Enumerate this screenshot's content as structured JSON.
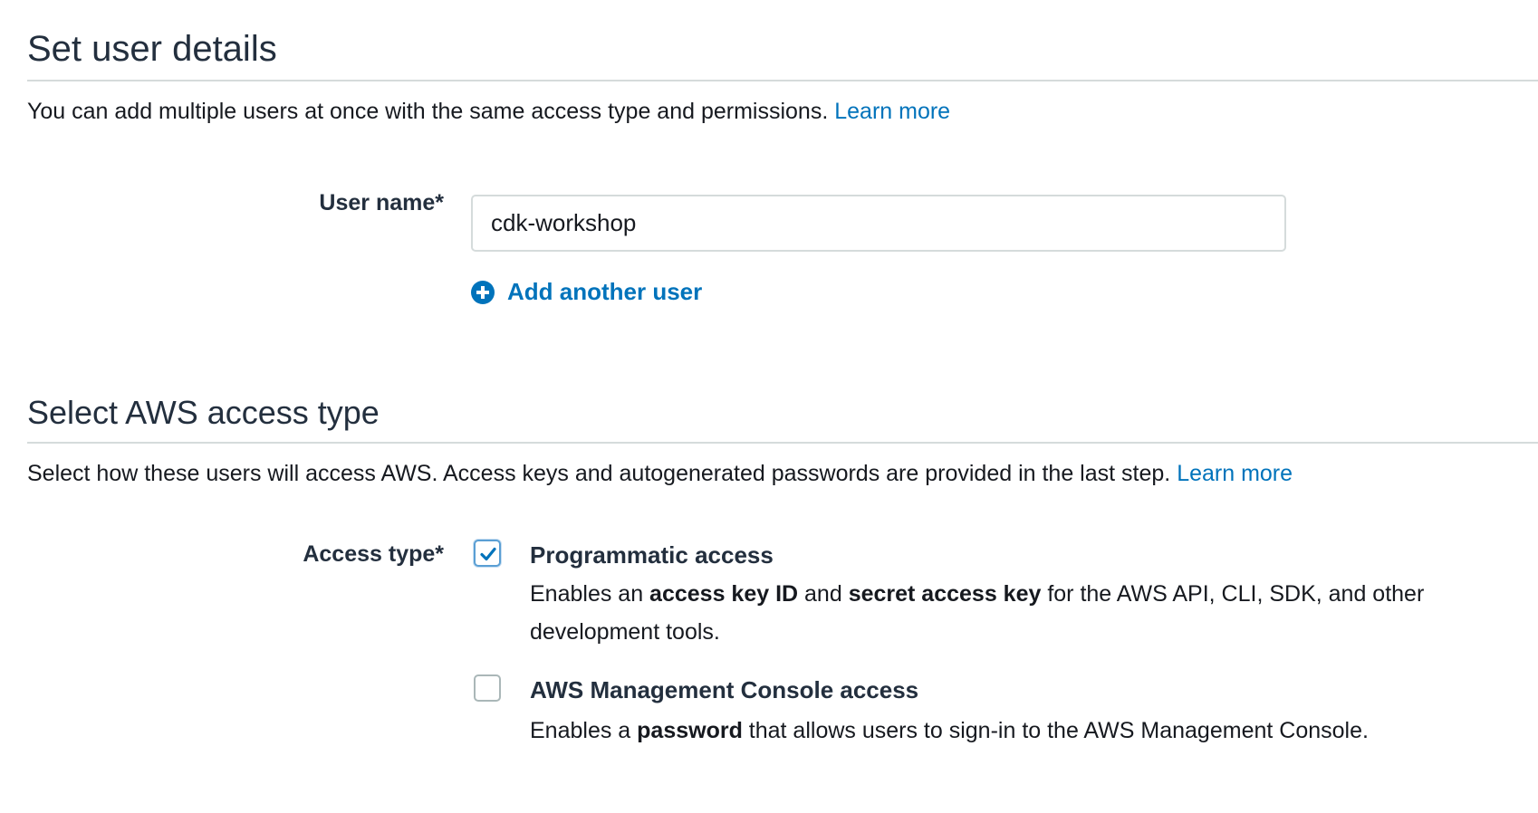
{
  "user_details": {
    "title": "Set user details",
    "description": "You can add multiple users at once with the same access type and permissions.",
    "learn_more": "Learn more",
    "user_name_label": "User name*",
    "user_name_value": "cdk-workshop",
    "add_another_user": "Add another user"
  },
  "access_type": {
    "title": "Select AWS access type",
    "description": "Select how these users will access AWS. Access keys and autogenerated passwords are provided in the last step.",
    "learn_more": "Learn more",
    "label": "Access type*",
    "options": [
      {
        "title": "Programmatic access",
        "checked": true,
        "desc_prefix": "Enables an ",
        "desc_bold_1": "access key ID",
        "desc_mid": " and ",
        "desc_bold_2": "secret access key",
        "desc_suffix": " for the AWS API, CLI, SDK, and other development tools."
      },
      {
        "title": "AWS Management Console access",
        "checked": false,
        "desc_prefix": "Enables a ",
        "desc_bold_1": "password",
        "desc_suffix": " that allows users to sign-in to the AWS Management Console."
      }
    ]
  },
  "colors": {
    "link": "#0073bb",
    "divider": "#d5dbdb",
    "checkbox_checked": "#0073bb"
  },
  "icons": {
    "add_user": "plus-circle-icon",
    "check": "check-icon"
  }
}
